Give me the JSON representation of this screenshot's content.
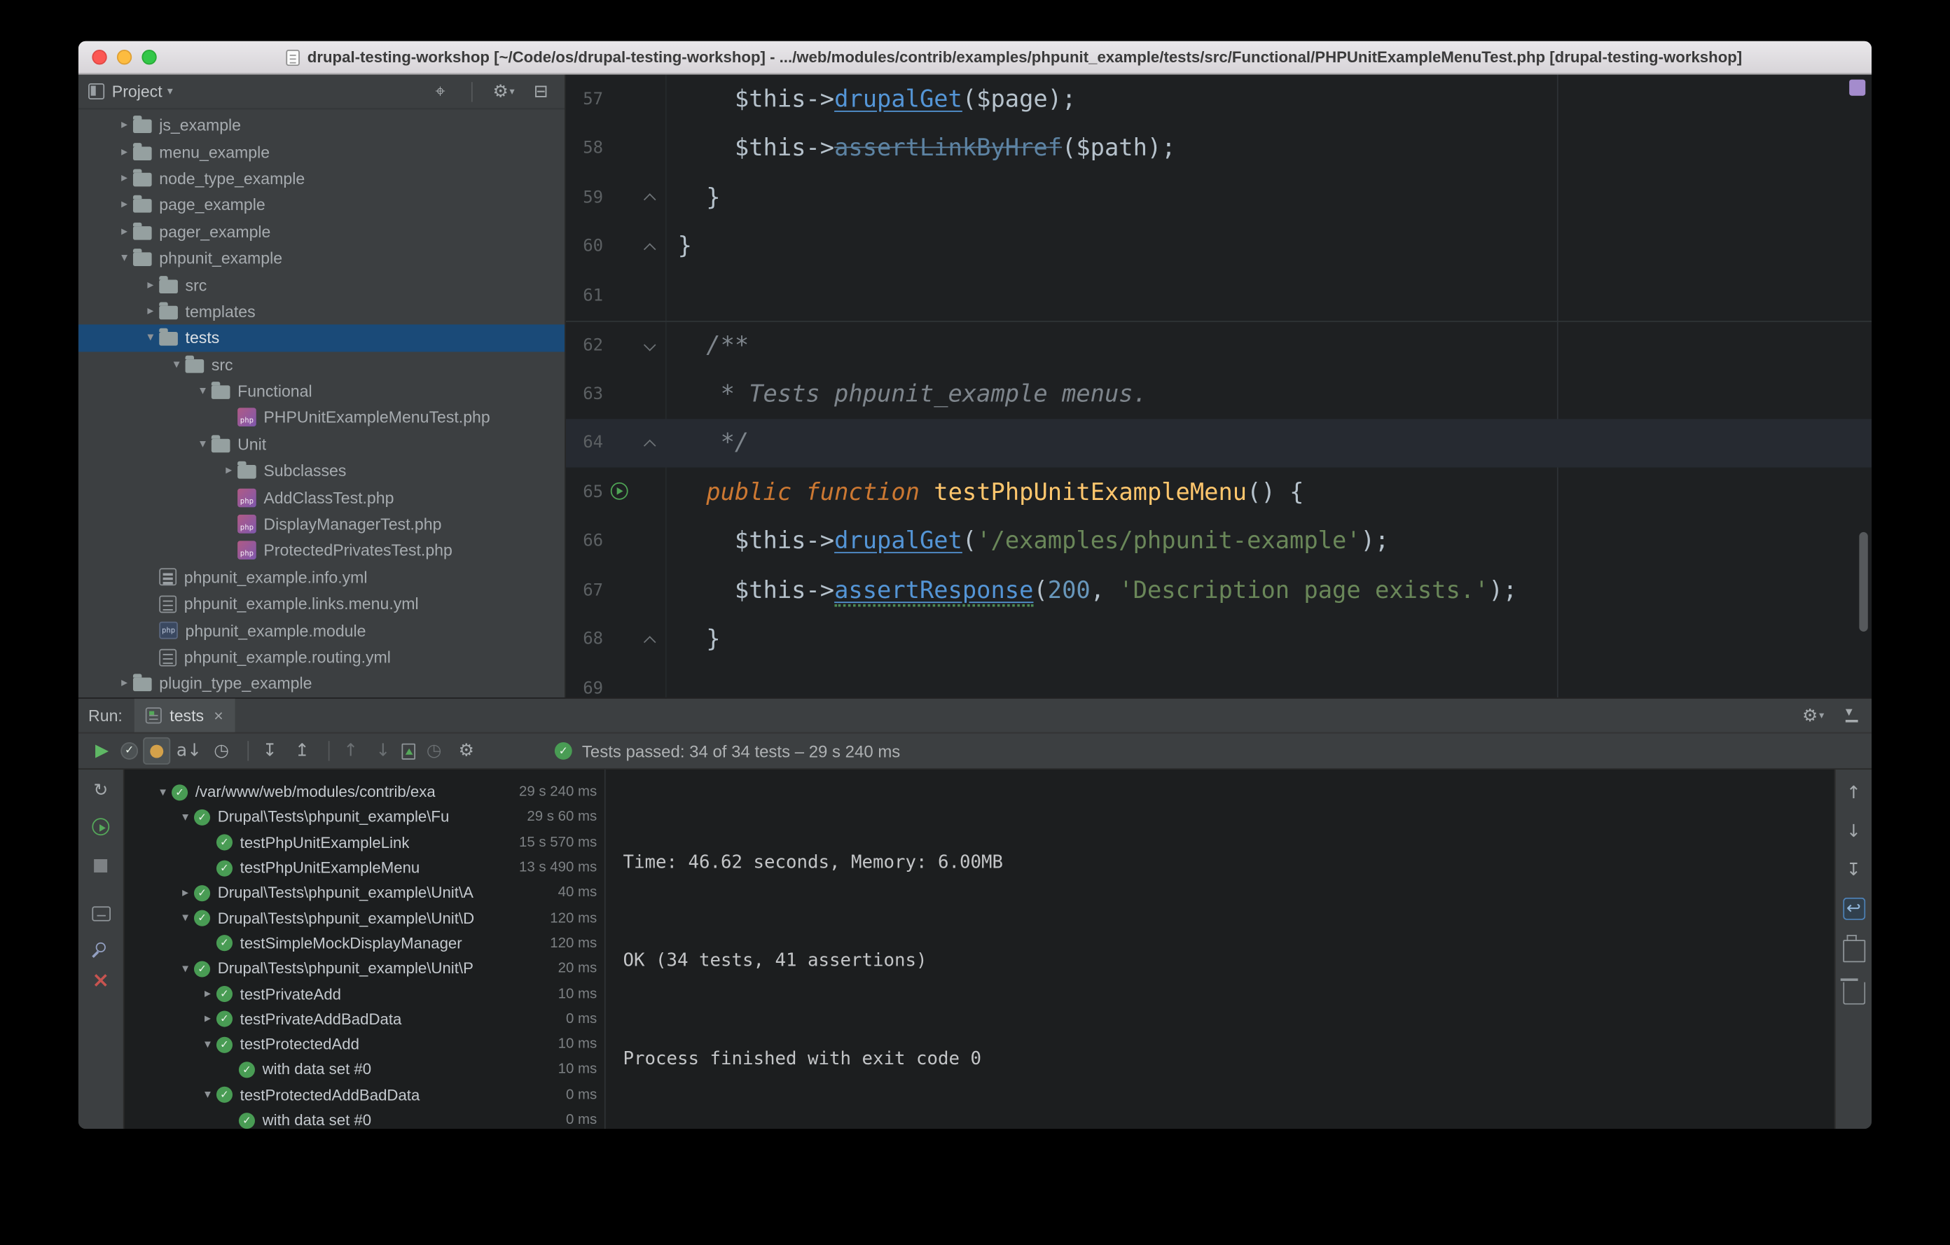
{
  "colors": {
    "selection_blue": "#1a4a78",
    "panel_bg": "#3c3f41",
    "editor_bg": "#1e2022",
    "console_bg": "#1c1e1f",
    "green_pass": "#499c54",
    "keyword_orange": "#cc7832",
    "string_green": "#6a8759",
    "number_blue": "#6897bb",
    "method_blue": "#5495d6",
    "func_yellow": "#ffc66d",
    "comment_gray": "#7e858c",
    "code_default": "#b6c2cc"
  },
  "titlebar": {
    "title": "drupal-testing-workshop [~/Code/os/drupal-testing-workshop] - .../web/modules/contrib/examples/phpunit_example/tests/src/Functional/PHPUnitExampleMenuTest.php [drupal-testing-workshop]"
  },
  "project_panel": {
    "header": {
      "title": "Project"
    },
    "header_icons": [
      {
        "name": "locate-file-icon",
        "glyph": "⌖"
      },
      {
        "name": "divider"
      },
      {
        "name": "settings-icon",
        "glyph": "⚙",
        "caret": true
      },
      {
        "name": "hide-project-panel-icon",
        "glyph": "⊟"
      }
    ],
    "tree": [
      {
        "label": "js_example",
        "level": 0,
        "arrow": "right",
        "icon": "folder"
      },
      {
        "label": "menu_example",
        "level": 0,
        "arrow": "right",
        "icon": "folder"
      },
      {
        "label": "node_type_example",
        "level": 0,
        "arrow": "right",
        "icon": "folder"
      },
      {
        "label": "page_example",
        "level": 0,
        "arrow": "right",
        "icon": "folder"
      },
      {
        "label": "pager_example",
        "level": 0,
        "arrow": "right",
        "icon": "folder"
      },
      {
        "label": "phpunit_example",
        "level": 0,
        "arrow": "down",
        "icon": "folder"
      },
      {
        "label": "src",
        "level": 1,
        "arrow": "right",
        "icon": "folder"
      },
      {
        "label": "templates",
        "level": 1,
        "arrow": "right",
        "icon": "folder"
      },
      {
        "label": "tests",
        "level": 1,
        "arrow": "down",
        "icon": "folder",
        "selected": true
      },
      {
        "label": "src",
        "level": 2,
        "arrow": "down",
        "icon": "folder"
      },
      {
        "label": "Functional",
        "level": 3,
        "arrow": "down",
        "icon": "folder"
      },
      {
        "label": "PHPUnitExampleMenuTest.php",
        "level": 4,
        "arrow": null,
        "icon": "phptest"
      },
      {
        "label": "Unit",
        "level": 3,
        "arrow": "down",
        "icon": "folder"
      },
      {
        "label": "Subclasses",
        "level": 4,
        "arrow": "right",
        "icon": "folder"
      },
      {
        "label": "AddClassTest.php",
        "level": 4,
        "arrow": null,
        "icon": "phptest"
      },
      {
        "label": "DisplayManagerTest.php",
        "level": 4,
        "arrow": null,
        "icon": "phptest"
      },
      {
        "label": "ProtectedPrivatesTest.php",
        "level": 4,
        "arrow": null,
        "icon": "phptest"
      },
      {
        "label": "phpunit_example.info.yml",
        "level": 1,
        "arrow": null,
        "icon": "yml"
      },
      {
        "label": "phpunit_example.links.menu.yml",
        "level": 1,
        "arrow": null,
        "icon": "yml"
      },
      {
        "label": "phpunit_example.module",
        "level": 1,
        "arrow": null,
        "icon": "php"
      },
      {
        "label": "phpunit_example.routing.yml",
        "level": 1,
        "arrow": null,
        "icon": "yml"
      },
      {
        "label": "plugin_type_example",
        "level": 0,
        "arrow": "right",
        "icon": "folder"
      }
    ]
  },
  "editor": {
    "lines": [
      {
        "num": 57,
        "segments": [
          [
            "    $this->",
            "plain"
          ],
          [
            "drupalGet",
            "method"
          ],
          [
            "($page);",
            "plain"
          ]
        ]
      },
      {
        "num": 58,
        "segments": [
          [
            "    $this->",
            "plain"
          ],
          [
            "assertLinkByHref",
            "method-strike"
          ],
          [
            "($path);",
            "plain"
          ]
        ]
      },
      {
        "num": 59,
        "fold": "up",
        "segments": [
          [
            "  }",
            "plain"
          ]
        ]
      },
      {
        "num": 60,
        "fold": "up",
        "segments": [
          [
            "}",
            "plain"
          ]
        ]
      },
      {
        "num": 61,
        "segments": []
      },
      {
        "num": 62,
        "fold": "down",
        "separator": true,
        "segments": [
          [
            "  /**",
            "comment"
          ]
        ]
      },
      {
        "num": 63,
        "segments": [
          [
            "   * Tests phpunit_example menus.",
            "comment"
          ]
        ]
      },
      {
        "num": 64,
        "fold": "up",
        "current": true,
        "segments": [
          [
            "   */",
            "comment"
          ]
        ]
      },
      {
        "num": 65,
        "run": true,
        "segments": [
          [
            "  ",
            "plain"
          ],
          [
            "public function",
            "keyword"
          ],
          [
            " ",
            "plain"
          ],
          [
            "testPhpUnitExampleMenu",
            "func"
          ],
          [
            "() {",
            "plain"
          ]
        ]
      },
      {
        "num": 66,
        "segments": [
          [
            "    $this->",
            "plain"
          ],
          [
            "drupalGet",
            "method"
          ],
          [
            "(",
            "plain"
          ],
          [
            "'/examples/phpunit-example'",
            "string"
          ],
          [
            ");",
            "plain"
          ]
        ]
      },
      {
        "num": 67,
        "segments": [
          [
            "    $this->",
            "plain"
          ],
          [
            "assertResponse",
            "method-warn"
          ],
          [
            "(",
            "plain"
          ],
          [
            "200",
            "number"
          ],
          [
            ", ",
            "plain"
          ],
          [
            "'Description page exists.'",
            "string"
          ],
          [
            ");",
            "plain"
          ]
        ]
      },
      {
        "num": 68,
        "fold": "up",
        "segments": [
          [
            "  }",
            "plain"
          ]
        ]
      },
      {
        "num": 69,
        "segments": []
      }
    ]
  },
  "run_panel": {
    "run_label": "Run:",
    "tab_label": "tests",
    "tab_close": "×",
    "status_text": "Tests passed: 34 of 34 tests – 29 s 240 ms",
    "tab_row_icons": [
      {
        "name": "settings-icon",
        "glyph": "⚙",
        "caret": true
      },
      {
        "name": "hide-run-panel-icon",
        "shape": "hide"
      }
    ],
    "toolbar_icons": [
      {
        "name": "rerun-tests-icon",
        "glyph": "▶",
        "color": "#5fb865"
      },
      {
        "name": "show-passed-icon",
        "shape": "check-circle",
        "toggled": true
      },
      {
        "name": "show-ignored-icon",
        "glyph": "●",
        "color": "#d4a14a",
        "toggled": true
      },
      {
        "name": "sort-alphabetically-icon",
        "glyph": "a↓"
      },
      {
        "name": "sort-by-duration-icon",
        "glyph": "◷"
      },
      {
        "name": "divider"
      },
      {
        "name": "expand-all-icon",
        "glyph": "↧"
      },
      {
        "name": "collapse-all-icon",
        "glyph": "↥"
      },
      {
        "name": "divider"
      },
      {
        "name": "previous-failed-test-icon",
        "glyph": "↑",
        "dim": true
      },
      {
        "name": "next-failed-test-icon",
        "glyph": "↓",
        "dim": true
      },
      {
        "name": "import-test-results-icon",
        "shape": "doc-up"
      },
      {
        "name": "test-history-icon",
        "glyph": "◷",
        "dim": true
      },
      {
        "name": "settings-icon",
        "glyph": "⚙"
      }
    ],
    "left_strip_icons": [
      {
        "name": "rerun-icon",
        "glyph": "↻"
      },
      {
        "name": "run-configuration-icon",
        "shape": "green-run"
      },
      {
        "name": "stop-icon",
        "glyph": "■",
        "color": "#7d8184"
      },
      {
        "name": "console-output-icon",
        "shape": "monitor"
      },
      {
        "name": "pin-tab-icon",
        "shape": "pin"
      },
      {
        "name": "close-panel-icon",
        "glyph": "×",
        "color": "#c75450"
      }
    ],
    "right_strip_icons": [
      {
        "name": "scroll-up-icon",
        "glyph": "↑"
      },
      {
        "name": "scroll-down-icon",
        "glyph": "↓"
      },
      {
        "name": "scroll-to-end-icon",
        "glyph": "↧"
      },
      {
        "name": "soft-wrap-icon",
        "glyph": "↩",
        "selected": true
      },
      {
        "name": "print-console-icon",
        "shape": "printer"
      },
      {
        "name": "clear-console-icon",
        "shape": "trash"
      }
    ],
    "test_tree": [
      {
        "label": "/var/www/web/modules/contrib/exa",
        "duration": "29 s 240 ms",
        "level": 0,
        "arrow": "down"
      },
      {
        "label": "Drupal\\Tests\\phpunit_example\\Fu",
        "duration": "29 s 60 ms",
        "level": 1,
        "arrow": "down"
      },
      {
        "label": "testPhpUnitExampleLink",
        "duration": "15 s 570 ms",
        "level": 2,
        "arrow": null
      },
      {
        "label": "testPhpUnitExampleMenu",
        "duration": "13 s 490 ms",
        "level": 2,
        "arrow": null
      },
      {
        "label": "Drupal\\Tests\\phpunit_example\\Unit\\A",
        "duration": "40 ms",
        "level": 1,
        "arrow": "right"
      },
      {
        "label": "Drupal\\Tests\\phpunit_example\\Unit\\D",
        "duration": "120 ms",
        "level": 1,
        "arrow": "down"
      },
      {
        "label": "testSimpleMockDisplayManager",
        "duration": "120 ms",
        "level": 2,
        "arrow": null
      },
      {
        "label": "Drupal\\Tests\\phpunit_example\\Unit\\P",
        "duration": "20 ms",
        "level": 1,
        "arrow": "down"
      },
      {
        "label": "testPrivateAdd",
        "duration": "10 ms",
        "level": 2,
        "arrow": "right"
      },
      {
        "label": "testPrivateAddBadData",
        "duration": "0 ms",
        "level": 2,
        "arrow": "right"
      },
      {
        "label": "testProtectedAdd",
        "duration": "10 ms",
        "level": 2,
        "arrow": "down"
      },
      {
        "label": "with data set #0",
        "duration": "10 ms",
        "level": 3,
        "arrow": null
      },
      {
        "label": "testProtectedAddBadData",
        "duration": "0 ms",
        "level": 2,
        "arrow": "down"
      },
      {
        "label": "with data set #0",
        "duration": "0 ms",
        "level": 3,
        "arrow": null
      }
    ],
    "console_lines": [
      "Time: 46.62 seconds, Memory: 6.00MB",
      "OK (34 tests, 41 assertions)",
      "Process finished with exit code 0"
    ]
  }
}
